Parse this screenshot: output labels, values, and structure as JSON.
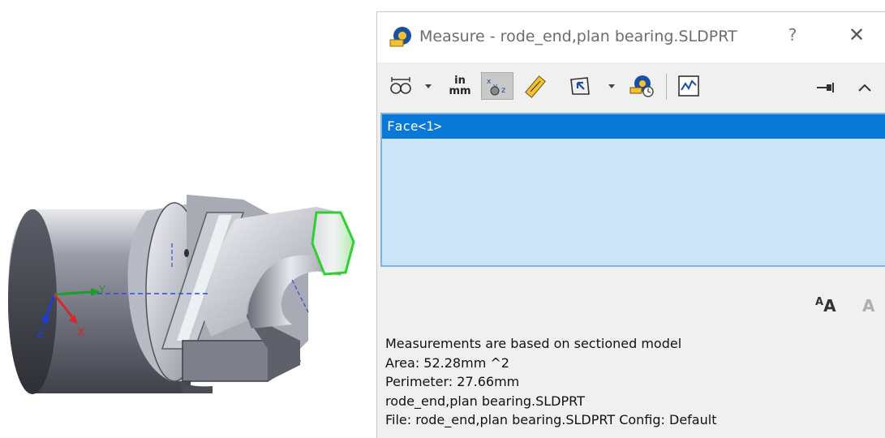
{
  "viewport": {
    "model_name": "rode_end,plan bearing",
    "axis_labels": {
      "x": "X",
      "y": "Y",
      "z": "Z"
    },
    "highlight_color": "#2ed12e"
  },
  "dialog": {
    "title": "Measure - rode_end,plan bearing.SLDPRT",
    "help_label": "?",
    "close_label": "✕",
    "toolbar": {
      "arc_circle_icon": "arc-circle-measure-icon",
      "units_top": "in",
      "units_bottom": "mm",
      "show_xyz_icon": "xyz-measure-icon",
      "point_to_point_icon": "point-to-point-icon",
      "projection_icon": "projection-icon",
      "measure_history_icon": "measure-history-icon",
      "sensor_icon": "create-sensor-icon",
      "pin_icon": "pin-icon",
      "collapse_icon": "collapse-icon"
    },
    "selection_list": [
      "Face<1>"
    ],
    "font_increase_label": "A",
    "font_decrease_label": "A",
    "results": [
      "Measurements are based on sectioned model",
      "Area: 52.28mm ^2",
      "Perimeter: 27.66mm",
      "rode_end,plan bearing.SLDPRT",
      "File: rode_end,plan bearing.SLDPRT Config: Default"
    ],
    "colors": {
      "accent": "#0a78d7",
      "list_background": "#cce4f7",
      "list_border": "#7ab4e8"
    }
  }
}
